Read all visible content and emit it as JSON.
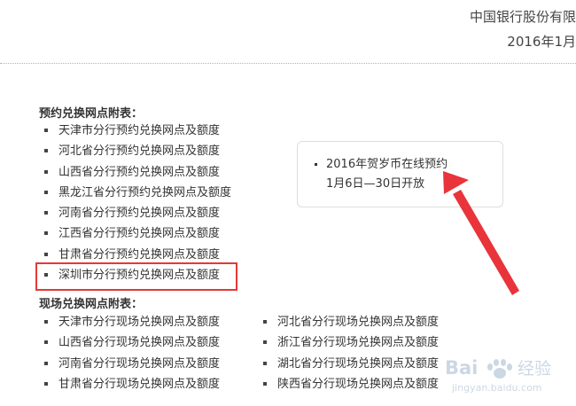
{
  "header": {
    "bank_name": "中国银行股份有限",
    "date": "2016年1月"
  },
  "section1": {
    "title": "预约兑换网点附表：",
    "items": [
      "天津市分行预约兑换网点及额度",
      "河北省分行预约兑换网点及额度",
      "山西省分行预约兑换网点及额度",
      "黑龙江省分行预约兑换网点及额度",
      "河南省分行预约兑换网点及额度",
      "江西省分行预约兑换网点及额度",
      "甘肃省分行预约兑换网点及额度",
      "深圳市分行预约兑换网点及额度"
    ]
  },
  "section2": {
    "title": "现场兑换网点附表：",
    "left_items": [
      "天津市分行现场兑换网点及额度",
      "山西省分行现场兑换网点及额度",
      "河南省分行现场兑换网点及额度",
      "甘肃省分行现场兑换网点及额度"
    ],
    "right_items": [
      "河北省分行现场兑换网点及额度",
      "浙江省分行现场兑换网点及额度",
      "湖北省分行现场兑换网点及额度",
      "陕西省分行现场兑换网点及额度"
    ]
  },
  "notice": {
    "line1": "2016年贺岁币在线预约",
    "line2": "1月6日—30日开放"
  },
  "watermark": {
    "brand": "Bai",
    "brand_suffix": "经验",
    "url": "jingyan.baidu.com"
  },
  "colors": {
    "highlight": "#e53935",
    "arrow": "#e8343a"
  }
}
